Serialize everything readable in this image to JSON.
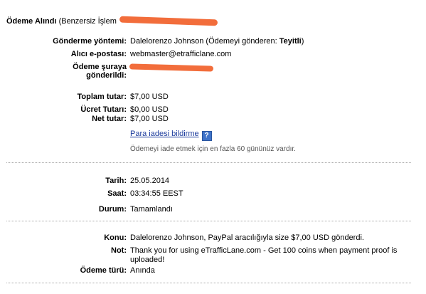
{
  "header": {
    "title": "Ödeme Alındı",
    "unique_id_label": "(Benzersiz İşlem"
  },
  "sender_section": {
    "method_label": "Gönderme yöntemi:",
    "method_value_prefix": "Dalelorenzo Johnson (Ödemeyi gönderen:",
    "method_value_status": "Teyitli",
    "method_value_suffix": ")",
    "recipient_email_label": "Alıcı e-postası:",
    "recipient_email_value": "webmaster@etrafficlane.com",
    "sent_to_label_1": "Ödeme şuraya",
    "sent_to_label_2": "gönderildi:"
  },
  "amount_section": {
    "total_label": "Toplam tutar:",
    "total_value": "$7,00 USD",
    "fee_label": "Ücret Tutarı:",
    "fee_value": "$0,00 USD",
    "net_label": "Net tutar:",
    "net_value": "$7,00 USD",
    "refund_link": "Para iadesi bildirme",
    "help_icon": "?",
    "refund_note": "Ödemeyi iade etmek için en fazla 60 gününüz vardır."
  },
  "date_section": {
    "date_label": "Tarih:",
    "date_value": "25.05.2014",
    "time_label": "Saat:",
    "time_value": "03:34:55 EEST",
    "status_label": "Durum:",
    "status_value": "Tamamlandı"
  },
  "details_section": {
    "subject_label": "Konu:",
    "subject_value": "Dalelorenzo Johnson, PayPal aracılığıyla size $7,00 USD gönderdi.",
    "note_label": "Not:",
    "note_value": "Thank you for using eTrafficLane.com - Get 100 coins when payment proof is uploaded!",
    "payment_type_label": "Ödeme türü:",
    "payment_type_value": "Anında"
  },
  "colors": {
    "redaction": "#f26d3b",
    "link": "#1a3a9c",
    "help_icon_bg": "#3f73c9"
  }
}
